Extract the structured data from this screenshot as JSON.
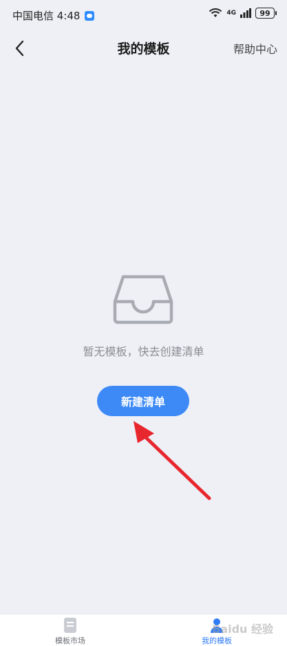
{
  "status_bar": {
    "carrier_time": "中国电信 4:48",
    "network": "4G",
    "battery": "99"
  },
  "nav": {
    "title": "我的模板",
    "help": "帮助中心"
  },
  "empty_state": {
    "message": "暂无模板，快去创建清单",
    "button_label": "新建清单"
  },
  "tabs": [
    {
      "label": "模板市场",
      "icon": "document-icon",
      "active": false
    },
    {
      "label": "我的模板",
      "icon": "person-icon",
      "active": true
    }
  ],
  "watermark": "Baidu 经验",
  "colors": {
    "accent": "#3d8af7",
    "background": "#eef0f6",
    "annotation_arrow": "#e8262d"
  }
}
